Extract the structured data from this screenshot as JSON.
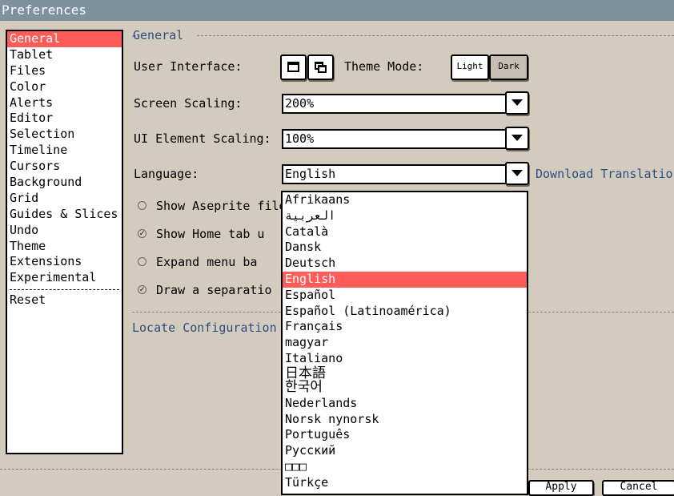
{
  "window": {
    "title": "Preferences"
  },
  "sidebar": {
    "items": [
      {
        "label": "General",
        "selected": true
      },
      {
        "label": "Tablet"
      },
      {
        "label": "Files"
      },
      {
        "label": "Color"
      },
      {
        "label": "Alerts"
      },
      {
        "label": "Editor"
      },
      {
        "label": "Selection"
      },
      {
        "label": "Timeline"
      },
      {
        "label": "Cursors"
      },
      {
        "label": "Background"
      },
      {
        "label": "Grid"
      },
      {
        "label": "Guides & Slices"
      },
      {
        "label": "Undo"
      },
      {
        "label": "Theme"
      },
      {
        "label": "Extensions"
      },
      {
        "label": "Experimental"
      }
    ],
    "reset_label": "Reset"
  },
  "general": {
    "section_title": "General",
    "user_interface_label": "User Interface:",
    "theme_mode_label": "Theme Mode:",
    "theme_light": "Light",
    "theme_dark": "Dark",
    "screen_scaling_label": "Screen Scaling:",
    "screen_scaling_value": "200%",
    "ui_scaling_label": "UI Element Scaling:",
    "ui_scaling_value": "100%",
    "language_label": "Language:",
    "language_value": "English",
    "download_translations": "Download Translatio",
    "option1": "Show Aseprite file",
    "option2": "Show Home tab u",
    "option3": "Expand menu ba",
    "option4": "Draw a separatio",
    "locate_config": "Locate Configuration"
  },
  "language_list": {
    "items": [
      "Afrikaans",
      "العربية",
      "Català",
      "Dansk",
      "Deutsch",
      "English",
      "Español",
      "Español (Latinoamérica)",
      "Français",
      "magyar",
      "Italiano",
      "日本語\n한국어",
      "Nederlands",
      "Norsk nynorsk",
      "Português",
      "Русский",
      "□□□",
      "Türkçe"
    ],
    "selected": "English"
  },
  "footer": {
    "apply_label": "Apply",
    "cancel_label": "Cancel"
  }
}
